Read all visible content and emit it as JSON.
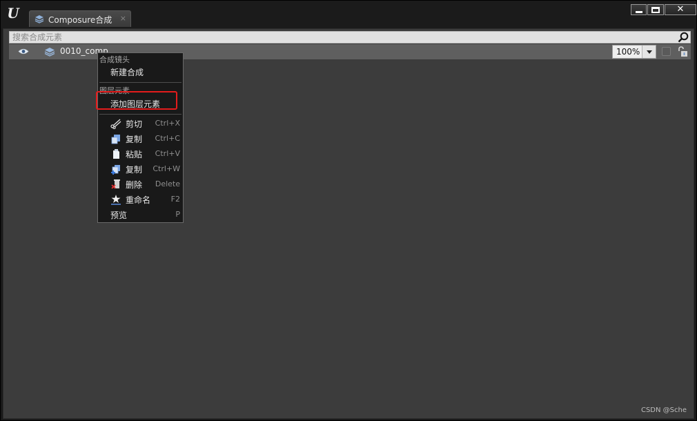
{
  "tab": {
    "title": "Composure合成",
    "close": "×"
  },
  "window_buttons": {
    "close": "✕"
  },
  "search": {
    "placeholder": "搜索合成元素"
  },
  "row": {
    "name": "0010_comp"
  },
  "zoom": {
    "value": "100%"
  },
  "context_menu": {
    "section_shot": "合成镜头",
    "new_comp": "新建合成",
    "section_layer": "图层元素",
    "add_layer": "添加图层元素",
    "items": [
      {
        "label": "剪切",
        "shortcut": "Ctrl+X",
        "icon": "scissors-icon"
      },
      {
        "label": "复制",
        "shortcut": "Ctrl+C",
        "icon": "copy-icon"
      },
      {
        "label": "粘贴",
        "shortcut": "Ctrl+V",
        "icon": "paste-icon"
      },
      {
        "label": "复制",
        "shortcut": "Ctrl+W",
        "icon": "duplicate-icon"
      },
      {
        "label": "删除",
        "shortcut": "Delete",
        "icon": "delete-icon"
      },
      {
        "label": "重命名",
        "shortcut": "F2",
        "icon": "rename-icon"
      },
      {
        "label": "预览",
        "shortcut": "P",
        "icon": ""
      }
    ]
  },
  "watermark": "CSDN @Sche",
  "colors": {
    "highlight_border": "#e51c1c",
    "panel_bg": "#3c3c3c",
    "row_bg": "#5f5f5f",
    "menu_bg": "#191919"
  }
}
